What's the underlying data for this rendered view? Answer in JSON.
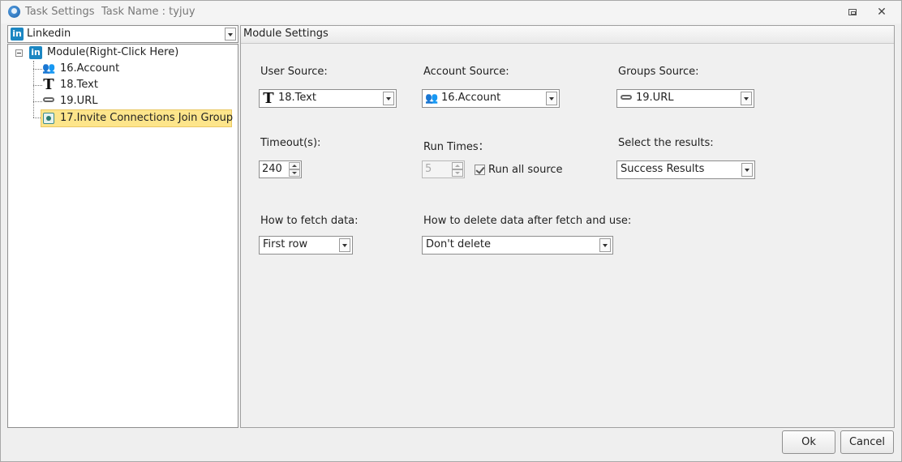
{
  "window": {
    "title": "Task Settings",
    "task_name": "Task Name : tyjuy"
  },
  "left_panel": {
    "platform_selector": "Linkedin",
    "tree": {
      "root_label": "Module(Right-Click Here)",
      "items": [
        {
          "label": "16.Account",
          "icon": "account-icon"
        },
        {
          "label": "18.Text",
          "icon": "text-icon"
        },
        {
          "label": "19.URL",
          "icon": "link-icon"
        },
        {
          "label": "17.Invite Connections Join Group",
          "icon": "invite-icon",
          "selected": true
        }
      ]
    }
  },
  "module_settings": {
    "header": "Module Settings",
    "user_source": {
      "label": "User Source:",
      "value": "18.Text"
    },
    "account_source": {
      "label": "Account Source:",
      "value": "16.Account"
    },
    "groups_source": {
      "label": "Groups Source:",
      "value": "19.URL"
    },
    "timeout": {
      "label": "Timeout(s):",
      "value": "240"
    },
    "run_times": {
      "label": "Run Times：",
      "value": "5",
      "run_all_label": "Run all source",
      "run_all_checked": true
    },
    "select_results": {
      "label": "Select the results:",
      "value": "Success Results"
    },
    "fetch_data": {
      "label": "How to fetch data:",
      "value": "First row"
    },
    "delete_data": {
      "label": "How to delete data after fetch and use:",
      "value": "Don't delete"
    }
  },
  "footer": {
    "ok_label": "Ok",
    "cancel_label": "Cancel"
  }
}
